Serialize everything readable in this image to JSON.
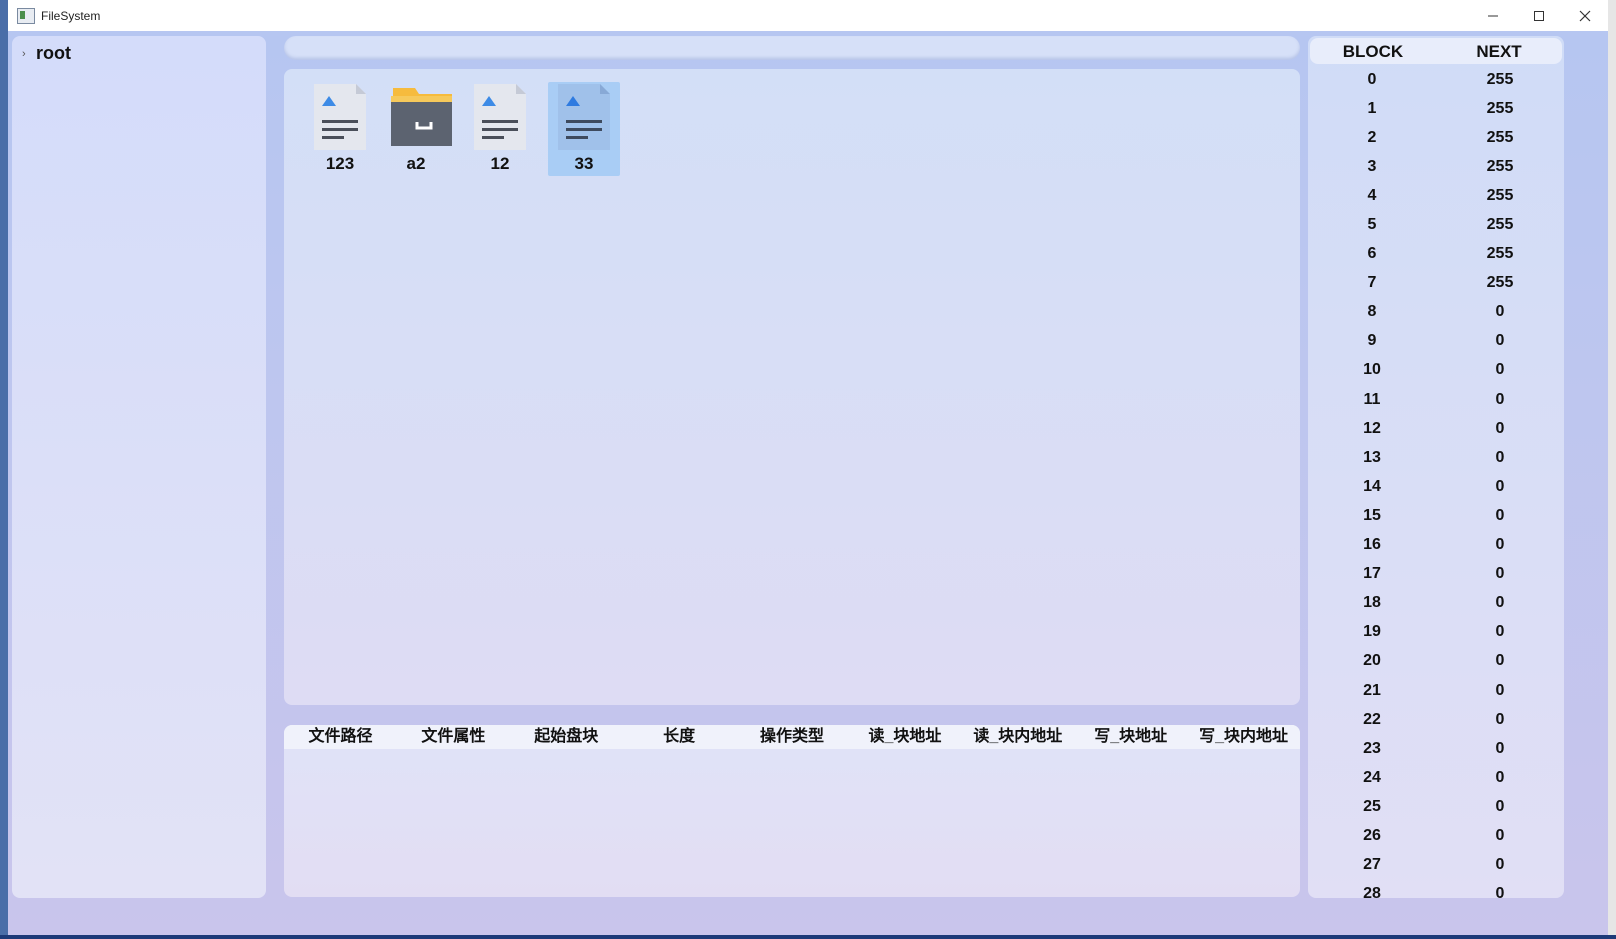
{
  "window": {
    "title": "FileSystem"
  },
  "tree": {
    "root_label": "root"
  },
  "files": [
    {
      "name": "123",
      "type": "file",
      "selected": false
    },
    {
      "name": "a2",
      "type": "folder",
      "selected": false
    },
    {
      "name": "12",
      "type": "file",
      "selected": false
    },
    {
      "name": "33",
      "type": "file",
      "selected": true
    }
  ],
  "log": {
    "columns": [
      "文件路径",
      "文件属性",
      "起始盘块",
      "长度",
      "操作类型",
      "读_块地址",
      "读_块内地址",
      "写_块地址",
      "写_块内地址"
    ]
  },
  "fat": {
    "headers": {
      "block": "BLOCK",
      "next": "NEXT"
    },
    "rows": [
      [
        "0",
        "255"
      ],
      [
        "1",
        "255"
      ],
      [
        "2",
        "255"
      ],
      [
        "3",
        "255"
      ],
      [
        "4",
        "255"
      ],
      [
        "5",
        "255"
      ],
      [
        "6",
        "255"
      ],
      [
        "7",
        "255"
      ],
      [
        "8",
        "0"
      ],
      [
        "9",
        "0"
      ],
      [
        "10",
        "0"
      ],
      [
        "11",
        "0"
      ],
      [
        "12",
        "0"
      ],
      [
        "13",
        "0"
      ],
      [
        "14",
        "0"
      ],
      [
        "15",
        "0"
      ],
      [
        "16",
        "0"
      ],
      [
        "17",
        "0"
      ],
      [
        "18",
        "0"
      ],
      [
        "19",
        "0"
      ],
      [
        "20",
        "0"
      ],
      [
        "21",
        "0"
      ],
      [
        "22",
        "0"
      ],
      [
        "23",
        "0"
      ],
      [
        "24",
        "0"
      ],
      [
        "25",
        "0"
      ],
      [
        "26",
        "0"
      ],
      [
        "27",
        "0"
      ],
      [
        "28",
        "0"
      ]
    ]
  },
  "colors": {
    "accent": "#a9cdf5",
    "folder": "#f6bb3d",
    "folder_body": "#5c6370",
    "doc_icon": "#3d8be6"
  }
}
